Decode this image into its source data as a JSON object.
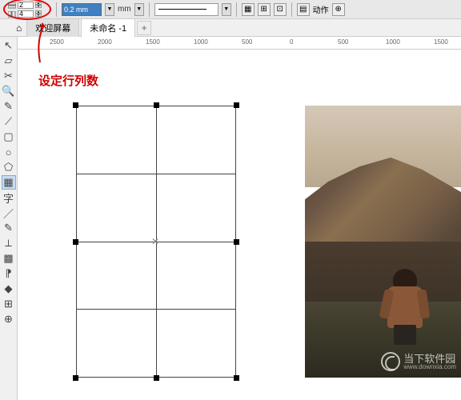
{
  "toolbar": {
    "rows_value": "2",
    "cols_value": "4",
    "outline_width": "0.2 mm",
    "unit_label": "mm",
    "action_label": "动作"
  },
  "tabs": {
    "welcome": "欢迎屏幕",
    "untitled": "未命名 -1",
    "add": "+"
  },
  "ruler": {
    "ticks": [
      "2500",
      "2000",
      "1500",
      "1000",
      "500",
      "0",
      "500",
      "1000",
      "1500"
    ]
  },
  "annotation": {
    "text": "设定行列数"
  },
  "tools": {
    "pick": "↖",
    "shape": "▱",
    "crop": "✂",
    "zoom": "🔍",
    "freehand": "✎",
    "bezier": "⟋",
    "rect": "▢",
    "ellipse": "○",
    "polygon": "⬠",
    "table": "▦",
    "text": "字",
    "line": "／",
    "eyedrop": "✎",
    "dim": "⟂",
    "transparency": "▩",
    "dropper": "⁋",
    "fill": "◆",
    "mesh": "⊞",
    "effect": "⊕"
  },
  "watermark": {
    "name": "当下软件园",
    "url": "www.downxia.com"
  }
}
